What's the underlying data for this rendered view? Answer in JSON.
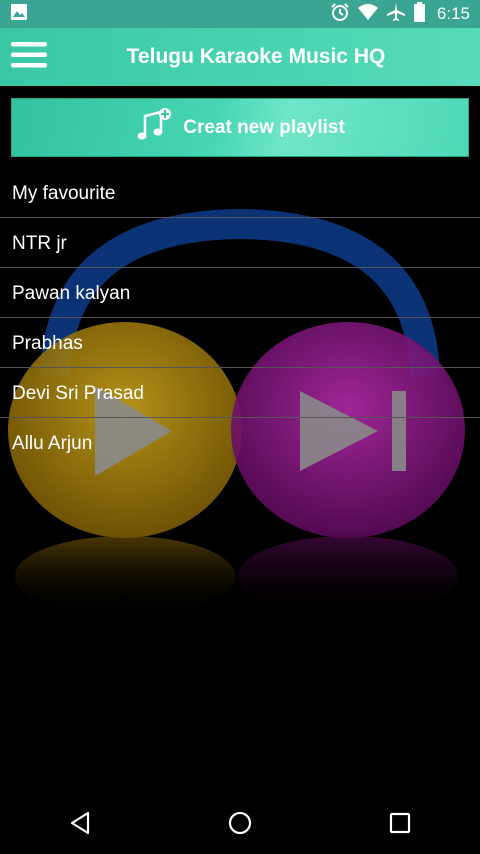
{
  "status_bar": {
    "time": "6:15",
    "icons": [
      "image-icon",
      "alarm-icon",
      "wifi-icon",
      "airplane-icon",
      "battery-icon"
    ]
  },
  "app_bar": {
    "title": "Telugu Karaoke Music HQ",
    "menu_icon": "hamburger-menu-icon"
  },
  "create_playlist": {
    "label": "Creat new playlist",
    "icon": "music-note-add-icon"
  },
  "playlists": [
    {
      "label": "My favourite"
    },
    {
      "label": "NTR jr"
    },
    {
      "label": "Pawan kalyan"
    },
    {
      "label": "Prabhas"
    },
    {
      "label": "Devi Sri Prasad"
    },
    {
      "label": "Allu Arjun"
    }
  ],
  "nav_bar": {
    "icons": [
      "back-icon",
      "home-icon",
      "recents-icon"
    ]
  },
  "colors": {
    "accent": "#3ac5a3",
    "status_bar": "#3aa592",
    "background": "#000000"
  }
}
